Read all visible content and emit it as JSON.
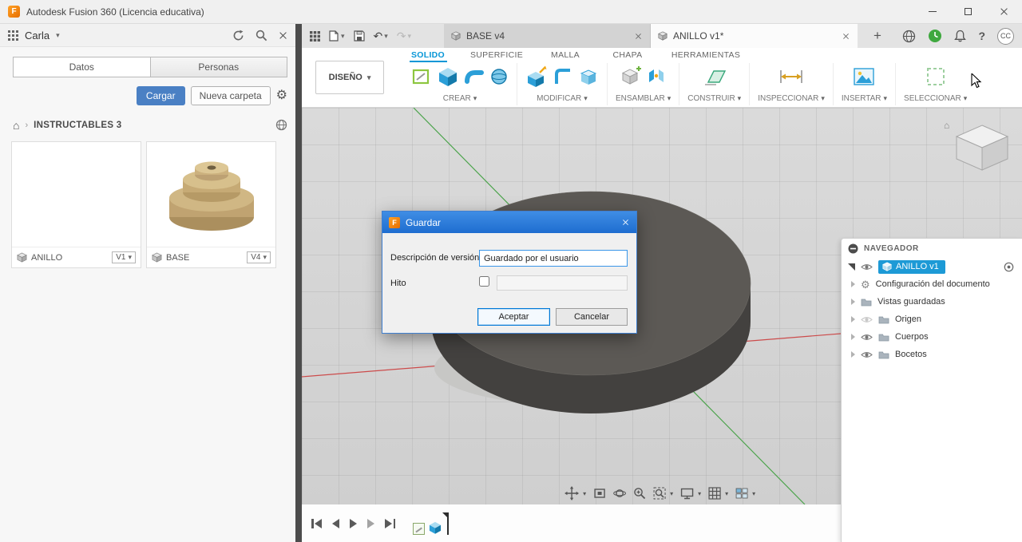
{
  "colors": {
    "accent_blue": "#0696d7",
    "dialog_titlebar_blue": "#2176d8",
    "upload_button_blue": "#4a80c4",
    "navigator_selection_blue": "#1d9ad6"
  },
  "icons": {
    "fusion_f": "F",
    "chevron_down": "▾",
    "breadcrumb_sep": "›",
    "home": "⌂",
    "gear": "⚙",
    "undo": "↶",
    "redo": "↷",
    "plus": "+",
    "question": "?"
  },
  "titlebar": {
    "title": "Autodesk Fusion 360 (Licencia educativa)"
  },
  "data_panel": {
    "user_name": "Carla",
    "tabs": [
      {
        "label": "Datos",
        "active": true
      },
      {
        "label": "Personas",
        "active": false
      }
    ],
    "upload_button": "Cargar",
    "new_folder_button": "Nueva carpeta",
    "breadcrumb": "INSTRUCTABLES 3",
    "items": [
      {
        "name": "ANILLO",
        "version": "V1"
      },
      {
        "name": "BASE",
        "version": "V4"
      }
    ]
  },
  "document_tabs": {
    "tabs": [
      {
        "label": "BASE v4",
        "active": false
      },
      {
        "label": "ANILLO v1*",
        "active": true
      }
    ],
    "avatar_initials": "CC"
  },
  "ribbon": {
    "design_menu": "DISEÑO",
    "tabs": [
      {
        "label": "SOLIDO",
        "active": true
      },
      {
        "label": "SUPERFICIE",
        "active": false
      },
      {
        "label": "MALLA",
        "active": false
      },
      {
        "label": "CHAPA",
        "active": false
      },
      {
        "label": "HERRAMIENTAS",
        "active": false
      }
    ],
    "groups": [
      {
        "label": "CREAR"
      },
      {
        "label": "MODIFICAR"
      },
      {
        "label": "ENSAMBLAR"
      },
      {
        "label": "CONSTRUIR"
      },
      {
        "label": "INSPECCIONAR"
      },
      {
        "label": "INSERTAR"
      },
      {
        "label": "SELECCIONAR"
      }
    ]
  },
  "save_dialog": {
    "title": "Guardar",
    "version_label": "Descripción de versión",
    "version_value": "Guardado por el usuario",
    "milestone_label": "Hito",
    "milestone_checked": false,
    "ok_button": "Aceptar",
    "cancel_button": "Cancelar"
  },
  "navigator": {
    "title": "NAVEGADOR",
    "root": {
      "label": "ANILLO v1",
      "selected": true
    },
    "items": [
      {
        "label": "Configuración del documento"
      },
      {
        "label": "Vistas guardadas"
      },
      {
        "label": "Origen"
      },
      {
        "label": "Cuerpos"
      },
      {
        "label": "Bocetos"
      }
    ]
  }
}
